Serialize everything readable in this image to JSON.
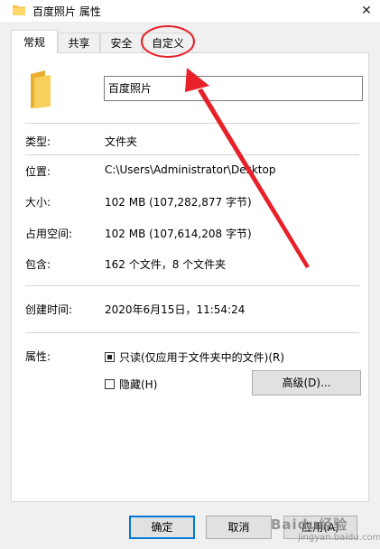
{
  "window": {
    "title": "百度照片 属性",
    "close_glyph": "✕"
  },
  "tabs": [
    {
      "label": "常规",
      "active": true
    },
    {
      "label": "共享",
      "active": false
    },
    {
      "label": "安全",
      "active": false
    },
    {
      "label": "自定义",
      "active": false
    }
  ],
  "general": {
    "folder_name": "百度照片",
    "rows": {
      "type": {
        "label": "类型:",
        "value": "文件夹"
      },
      "location": {
        "label": "位置:",
        "value": "C:\\Users\\Administrator\\Desktop"
      },
      "size": {
        "label": "大小:",
        "value": "102 MB (107,282,877 字节)"
      },
      "size_on_disk": {
        "label": "占用空间:",
        "value": "102 MB (107,614,208 字节)"
      },
      "contains": {
        "label": "包含:",
        "value": "162 个文件，8 个文件夹"
      },
      "created": {
        "label": "创建时间:",
        "value": "2020年6月15日，11:54:24"
      }
    },
    "attributes": {
      "label": "属性:",
      "readonly_label": "只读(仅应用于文件夹中的文件)(R)",
      "readonly_state": "indeterminate",
      "hidden_label": "隐藏(H)",
      "hidden_checked": false,
      "advanced_button": "高级(D)..."
    }
  },
  "footer": {
    "ok": "确定",
    "cancel": "取消",
    "apply": "应用(A)"
  },
  "watermark": {
    "text": "Baidu经验",
    "sub": "jingyan.baidu.com"
  },
  "colors": {
    "annotation": "#e8202a",
    "folder": "#f5c44e",
    "default_button": "#0078d7"
  },
  "icons": {
    "title": "folder-icon",
    "large": "folder-icon"
  }
}
